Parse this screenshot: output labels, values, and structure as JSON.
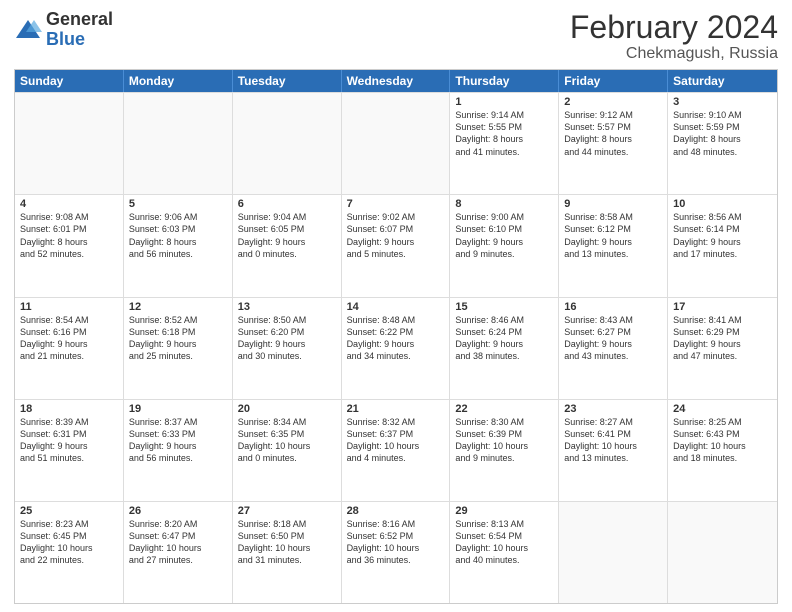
{
  "logo": {
    "general": "General",
    "blue": "Blue"
  },
  "title": "February 2024",
  "subtitle": "Chekmagush, Russia",
  "days_of_week": [
    "Sunday",
    "Monday",
    "Tuesday",
    "Wednesday",
    "Thursday",
    "Friday",
    "Saturday"
  ],
  "rows": [
    [
      {
        "day": "",
        "info": ""
      },
      {
        "day": "",
        "info": ""
      },
      {
        "day": "",
        "info": ""
      },
      {
        "day": "",
        "info": ""
      },
      {
        "day": "1",
        "info": "Sunrise: 9:14 AM\nSunset: 5:55 PM\nDaylight: 8 hours\nand 41 minutes."
      },
      {
        "day": "2",
        "info": "Sunrise: 9:12 AM\nSunset: 5:57 PM\nDaylight: 8 hours\nand 44 minutes."
      },
      {
        "day": "3",
        "info": "Sunrise: 9:10 AM\nSunset: 5:59 PM\nDaylight: 8 hours\nand 48 minutes."
      }
    ],
    [
      {
        "day": "4",
        "info": "Sunrise: 9:08 AM\nSunset: 6:01 PM\nDaylight: 8 hours\nand 52 minutes."
      },
      {
        "day": "5",
        "info": "Sunrise: 9:06 AM\nSunset: 6:03 PM\nDaylight: 8 hours\nand 56 minutes."
      },
      {
        "day": "6",
        "info": "Sunrise: 9:04 AM\nSunset: 6:05 PM\nDaylight: 9 hours\nand 0 minutes."
      },
      {
        "day": "7",
        "info": "Sunrise: 9:02 AM\nSunset: 6:07 PM\nDaylight: 9 hours\nand 5 minutes."
      },
      {
        "day": "8",
        "info": "Sunrise: 9:00 AM\nSunset: 6:10 PM\nDaylight: 9 hours\nand 9 minutes."
      },
      {
        "day": "9",
        "info": "Sunrise: 8:58 AM\nSunset: 6:12 PM\nDaylight: 9 hours\nand 13 minutes."
      },
      {
        "day": "10",
        "info": "Sunrise: 8:56 AM\nSunset: 6:14 PM\nDaylight: 9 hours\nand 17 minutes."
      }
    ],
    [
      {
        "day": "11",
        "info": "Sunrise: 8:54 AM\nSunset: 6:16 PM\nDaylight: 9 hours\nand 21 minutes."
      },
      {
        "day": "12",
        "info": "Sunrise: 8:52 AM\nSunset: 6:18 PM\nDaylight: 9 hours\nand 25 minutes."
      },
      {
        "day": "13",
        "info": "Sunrise: 8:50 AM\nSunset: 6:20 PM\nDaylight: 9 hours\nand 30 minutes."
      },
      {
        "day": "14",
        "info": "Sunrise: 8:48 AM\nSunset: 6:22 PM\nDaylight: 9 hours\nand 34 minutes."
      },
      {
        "day": "15",
        "info": "Sunrise: 8:46 AM\nSunset: 6:24 PM\nDaylight: 9 hours\nand 38 minutes."
      },
      {
        "day": "16",
        "info": "Sunrise: 8:43 AM\nSunset: 6:27 PM\nDaylight: 9 hours\nand 43 minutes."
      },
      {
        "day": "17",
        "info": "Sunrise: 8:41 AM\nSunset: 6:29 PM\nDaylight: 9 hours\nand 47 minutes."
      }
    ],
    [
      {
        "day": "18",
        "info": "Sunrise: 8:39 AM\nSunset: 6:31 PM\nDaylight: 9 hours\nand 51 minutes."
      },
      {
        "day": "19",
        "info": "Sunrise: 8:37 AM\nSunset: 6:33 PM\nDaylight: 9 hours\nand 56 minutes."
      },
      {
        "day": "20",
        "info": "Sunrise: 8:34 AM\nSunset: 6:35 PM\nDaylight: 10 hours\nand 0 minutes."
      },
      {
        "day": "21",
        "info": "Sunrise: 8:32 AM\nSunset: 6:37 PM\nDaylight: 10 hours\nand 4 minutes."
      },
      {
        "day": "22",
        "info": "Sunrise: 8:30 AM\nSunset: 6:39 PM\nDaylight: 10 hours\nand 9 minutes."
      },
      {
        "day": "23",
        "info": "Sunrise: 8:27 AM\nSunset: 6:41 PM\nDaylight: 10 hours\nand 13 minutes."
      },
      {
        "day": "24",
        "info": "Sunrise: 8:25 AM\nSunset: 6:43 PM\nDaylight: 10 hours\nand 18 minutes."
      }
    ],
    [
      {
        "day": "25",
        "info": "Sunrise: 8:23 AM\nSunset: 6:45 PM\nDaylight: 10 hours\nand 22 minutes."
      },
      {
        "day": "26",
        "info": "Sunrise: 8:20 AM\nSunset: 6:47 PM\nDaylight: 10 hours\nand 27 minutes."
      },
      {
        "day": "27",
        "info": "Sunrise: 8:18 AM\nSunset: 6:50 PM\nDaylight: 10 hours\nand 31 minutes."
      },
      {
        "day": "28",
        "info": "Sunrise: 8:16 AM\nSunset: 6:52 PM\nDaylight: 10 hours\nand 36 minutes."
      },
      {
        "day": "29",
        "info": "Sunrise: 8:13 AM\nSunset: 6:54 PM\nDaylight: 10 hours\nand 40 minutes."
      },
      {
        "day": "",
        "info": ""
      },
      {
        "day": "",
        "info": ""
      }
    ]
  ]
}
